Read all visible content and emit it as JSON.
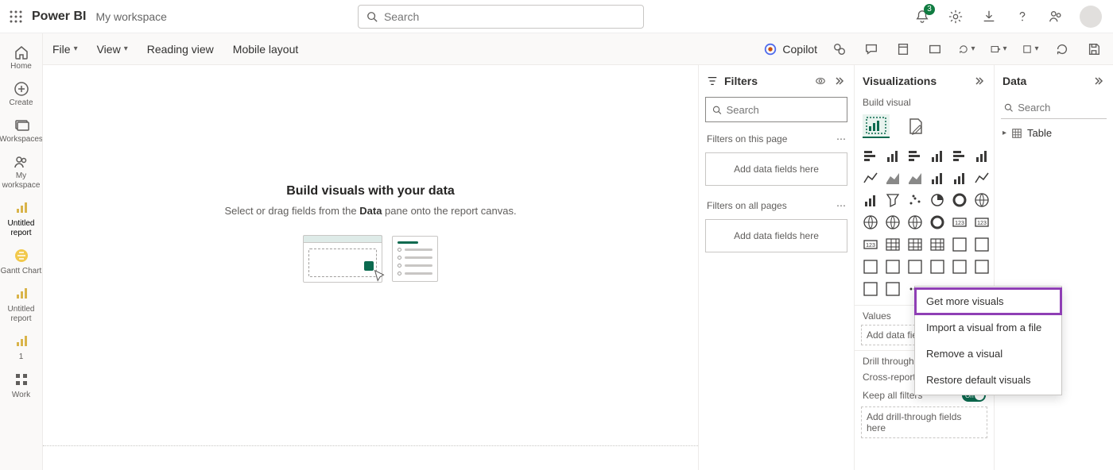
{
  "header": {
    "brand": "Power BI",
    "workspace": "My workspace",
    "search_placeholder": "Search",
    "notifications_count": "3"
  },
  "leftrail": {
    "home": "Home",
    "create": "Create",
    "workspaces": "Workspaces",
    "my_workspace": "My workspace",
    "untitled_report": "Untitled report",
    "gantt_chart": "Gantt Chart",
    "untitled_report_2": "Untitled report",
    "one": "1",
    "work": "Work"
  },
  "ribbon": {
    "file": "File",
    "view": "View",
    "reading_view": "Reading view",
    "mobile_layout": "Mobile layout",
    "copilot": "Copilot"
  },
  "canvas": {
    "title": "Build visuals with your data",
    "subtitle_pre": "Select or drag fields from the ",
    "subtitle_bold": "Data",
    "subtitle_post": " pane onto the report canvas."
  },
  "filters": {
    "title": "Filters",
    "search_placeholder": "Search",
    "on_this_page": "Filters on this page",
    "on_all_pages": "Filters on all pages",
    "add_fields": "Add data fields here"
  },
  "viz": {
    "title": "Visualizations",
    "build_visual": "Build visual",
    "values": "Values",
    "add_fields": "Add data fields here",
    "drill_through": "Drill through",
    "cross_report": "Cross-report",
    "keep_all_filters": "Keep all filters",
    "toggle_on": "On",
    "add_drill_fields": "Add drill-through fields here"
  },
  "data": {
    "title": "Data",
    "search_placeholder": "Search",
    "table": "Table"
  },
  "context_menu": {
    "get_more": "Get more visuals",
    "import_file": "Import a visual from a file",
    "remove": "Remove a visual",
    "restore": "Restore default visuals"
  },
  "viz_types": [
    "stacked-bar",
    "stacked-column",
    "clustered-bar",
    "clustered-column",
    "hundred-bar",
    "hundred-column",
    "line",
    "area",
    "stacked-area",
    "line-stacked-column",
    "line-clustered-column",
    "ribbon",
    "waterfall",
    "funnel",
    "scatter",
    "pie",
    "donut",
    "treemap",
    "map",
    "filled-map",
    "azure-map",
    "gauge",
    "card",
    "multi-row-card",
    "kpi",
    "slicer",
    "table",
    "matrix",
    "r-visual",
    "py-visual",
    "key-influencers",
    "decomposition-tree",
    "qna",
    "smart-narrative",
    "paginated",
    "power-apps",
    "power-automate",
    "arc-gis",
    "more-visuals"
  ]
}
